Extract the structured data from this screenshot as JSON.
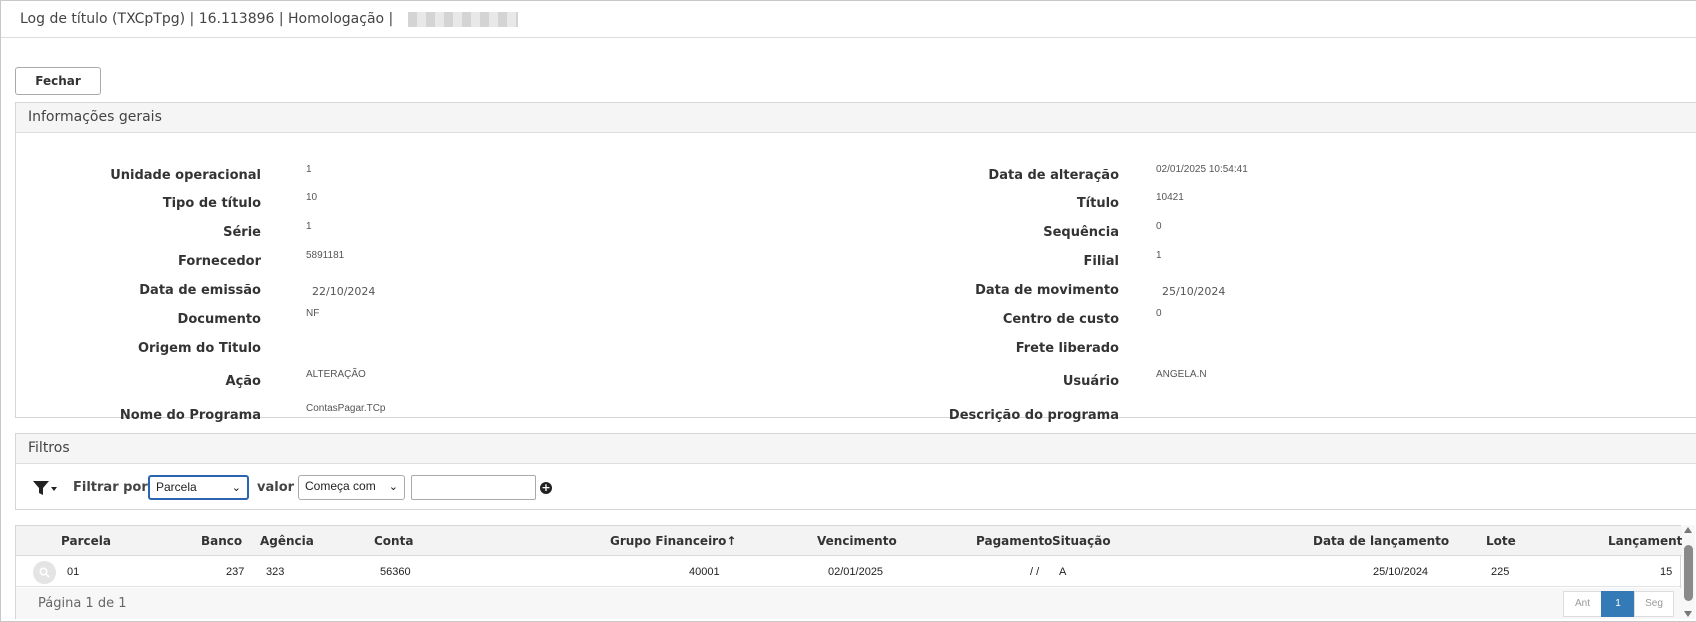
{
  "window": {
    "title": "Log de título (TXCpTpg) | 16.113896 | Homologação |"
  },
  "toolbar": {
    "fechar_label": "Fechar"
  },
  "info": {
    "header": "Informações gerais",
    "fields_left": [
      {
        "label": "Unidade operacional",
        "value": "1"
      },
      {
        "label": "Tipo de título",
        "value": "10"
      },
      {
        "label": "Série",
        "value": "1"
      },
      {
        "label": "Fornecedor",
        "value": "5891181"
      },
      {
        "label": "Data de emissão",
        "value": "22/10/2024"
      },
      {
        "label": "Documento",
        "value": "NF"
      },
      {
        "label": "Origem do Titulo",
        "value": ""
      },
      {
        "label": "Ação",
        "value": "ALTERAÇÃO"
      },
      {
        "label": "Nome do Programa",
        "value": "ContasPagar.TCp"
      }
    ],
    "fields_right": [
      {
        "label": "Data de alteração",
        "value": "02/01/2025 10:54:41"
      },
      {
        "label": "Título",
        "value": "10421"
      },
      {
        "label": "Sequência",
        "value": "0"
      },
      {
        "label": "Filial",
        "value": "1"
      },
      {
        "label": "Data de movimento",
        "value": "25/10/2024"
      },
      {
        "label": "Centro de custo",
        "value": "0"
      },
      {
        "label": "Frete liberado",
        "value": ""
      },
      {
        "label": "Usuário",
        "value": "ANGELA.N"
      },
      {
        "label": "Descrição do programa",
        "value": ""
      }
    ]
  },
  "filtros": {
    "header": "Filtros",
    "filter_by_label": "Filtrar por",
    "field_select": "Parcela",
    "valor_label": "valor",
    "operator_select": "Começa com",
    "value_input": "",
    "filter_icon": "filter-icon",
    "add_icon": "plus-circle-icon"
  },
  "grid": {
    "columns": [
      "Parcela",
      "Banco",
      "Agência",
      "Conta",
      "Grupo Financeiro",
      "Vencimento",
      "Pagamento",
      "Situação",
      "Data de lançamento",
      "Lote",
      "Lançamento"
    ],
    "sort_indicator": "↑",
    "rows": [
      {
        "parcela": "01",
        "banco": "237",
        "agencia": "323",
        "conta": "56360",
        "grupo": "40001",
        "vencimento": "02/01/2025",
        "pagamento": "/ /",
        "situacao": "A",
        "data_lancamento": "25/10/2024",
        "lote": "225",
        "lancamento": "15"
      }
    ],
    "page_info": "Página 1 de 1",
    "pager": {
      "prev": "Ant",
      "current": "1",
      "next": "Seg"
    }
  }
}
